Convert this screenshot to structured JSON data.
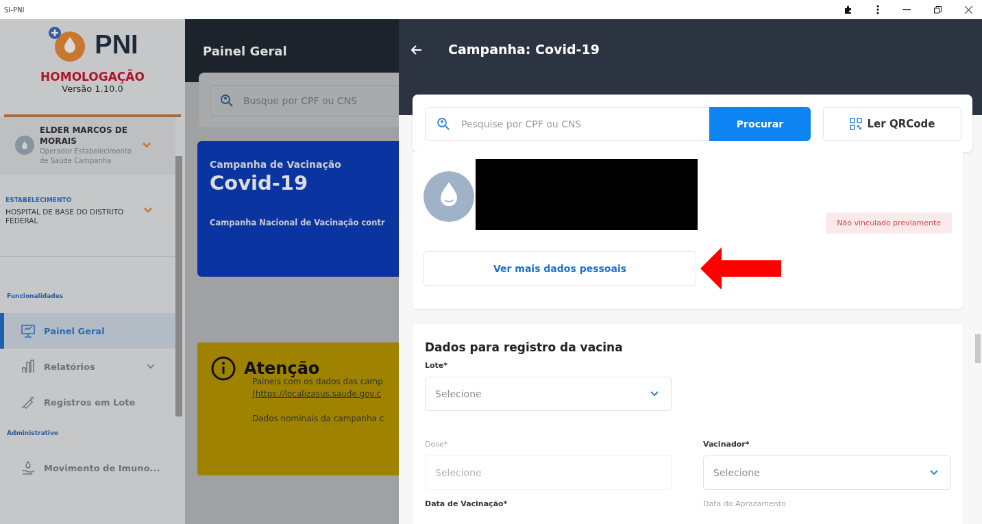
{
  "window": {
    "title": "SI-PNI"
  },
  "sidebar": {
    "logo_text": "PNI",
    "environment": "HOMOLOGAÇÃO",
    "version": "Versão 1.10.0",
    "user": {
      "name": "ELDER MARCOS DE MORAIS",
      "role": "Operador Estabelecimento de Saúde Campanha"
    },
    "establishment": {
      "label": "ESTABELECIMENTO",
      "name": "HOSPITAL DE BASE DO DISTRITO FEDERAL"
    },
    "sections": [
      {
        "title": "Funcionalidades",
        "items": [
          {
            "label": "Painel Geral",
            "selected": true,
            "expandable": false
          },
          {
            "label": "Relatórios",
            "selected": false,
            "expandable": true
          },
          {
            "label": "Registros em Lote",
            "selected": false,
            "expandable": false
          }
        ]
      },
      {
        "title": "Administrativo",
        "items": [
          {
            "label": "Movimento de Imuno...",
            "selected": false,
            "expandable": false
          }
        ]
      }
    ]
  },
  "main": {
    "title": "Painel Geral",
    "search": {
      "placeholder": "Busque por CPF ou CNS"
    },
    "campaign_card": {
      "subtitle": "Campanha de Vacinação",
      "title": "Covid-19",
      "description": "Campanha Nacional de Vacinação contr"
    },
    "notice": {
      "title": "Atenção",
      "text": "Paineis com os dados das camp",
      "link": "(https://localizasus.saude.gov.c",
      "text_2": "Dados nominais da campanha c"
    }
  },
  "drawer": {
    "title": "Campanha: Covid-19",
    "search": {
      "placeholder": "Pesquise por CPF ou CNS",
      "button": "Procurar",
      "qr_button": "Ler QRCode"
    },
    "profile": {
      "status": "Não vinculado previamente",
      "details_button": "Ver mais dados pessoais"
    },
    "form": {
      "title": "Dados para registro da vacina",
      "fields": [
        {
          "label": "Lote*",
          "placeholder": "Selecione",
          "disabled": false,
          "kind": "select"
        },
        {
          "label": "Dose*",
          "placeholder": "Selecione",
          "disabled": true,
          "kind": "select"
        },
        {
          "label": "Vacinador*",
          "placeholder": "Selecione",
          "disabled": false,
          "kind": "select"
        },
        {
          "label": "Data de Vacinação*",
          "disabled": false,
          "kind": "label"
        },
        {
          "label": "Data do Aprazamento",
          "disabled": true,
          "kind": "label"
        }
      ]
    }
  }
}
